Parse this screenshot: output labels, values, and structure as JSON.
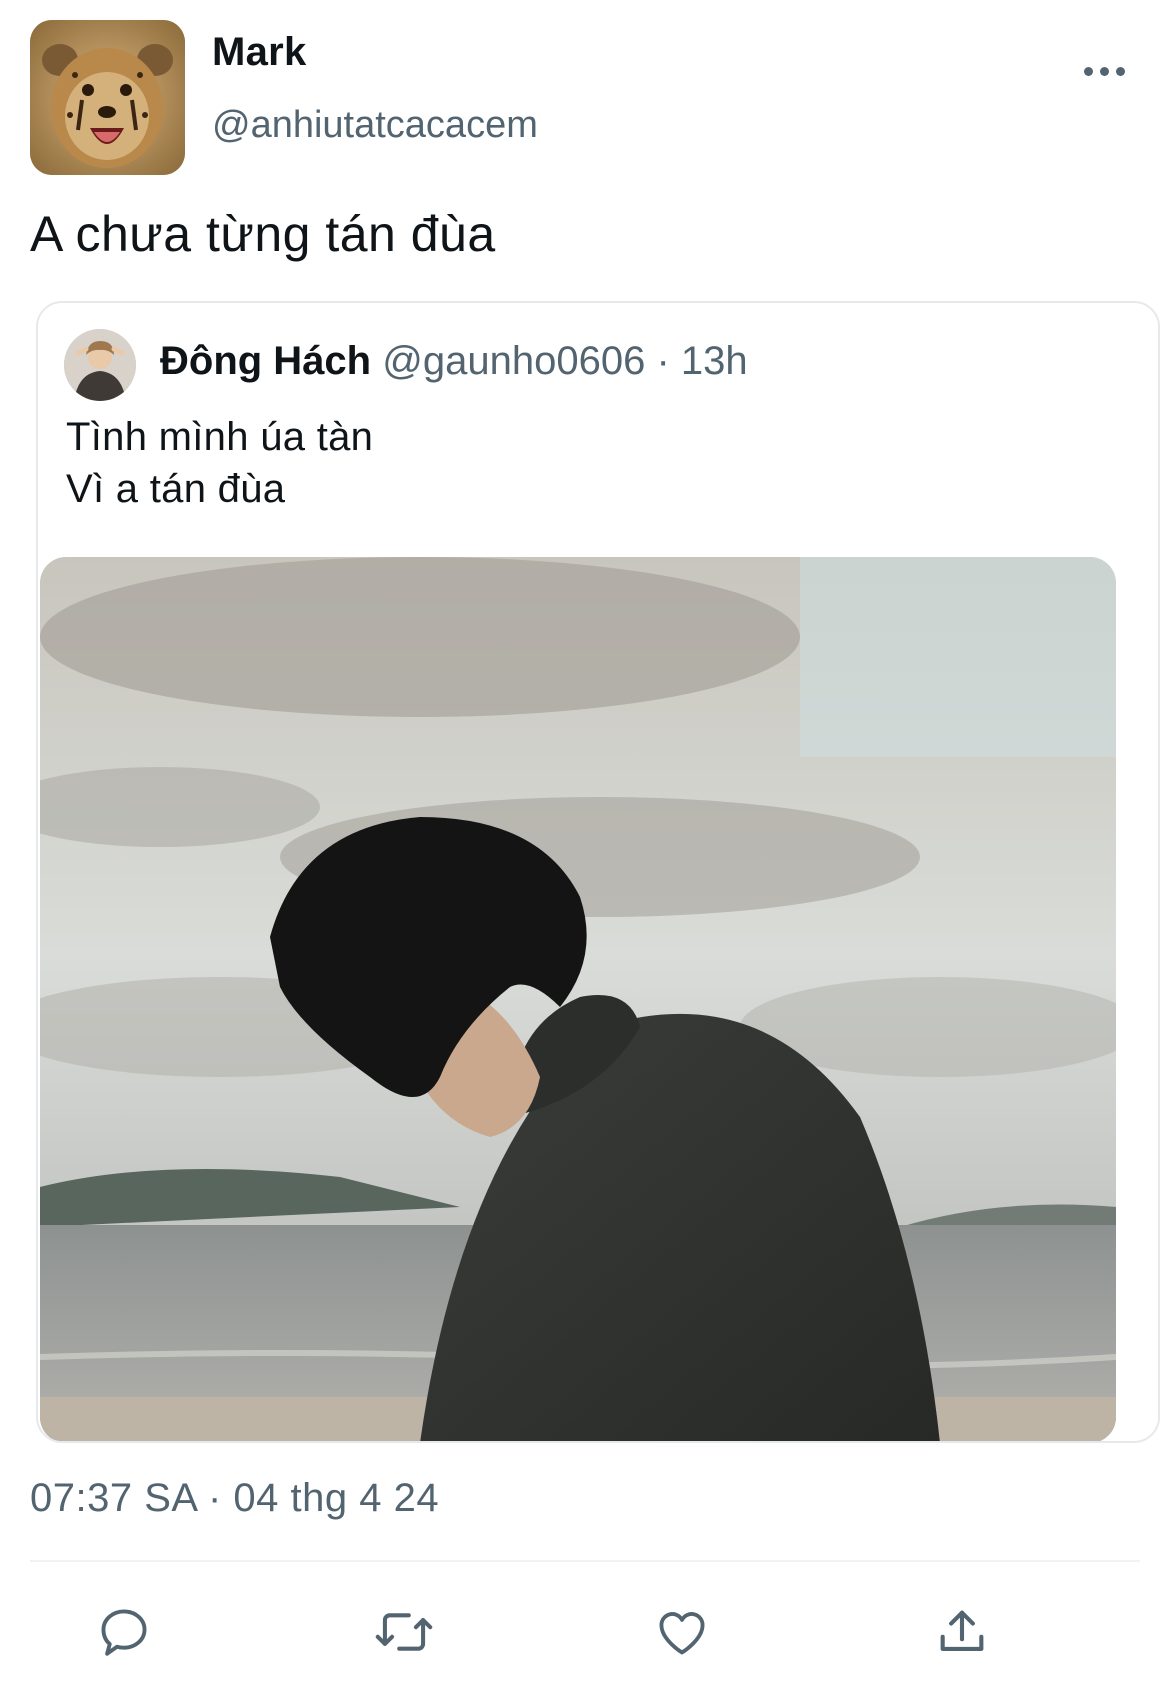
{
  "author": {
    "name": "Mark",
    "handle": "@anhiutatcacacem",
    "avatar_icon": "cheetah-cub-avatar"
  },
  "tweet": {
    "text": "A chưa từng tán đùa",
    "timestamp": "07:37 SA · 04 thg 4 24"
  },
  "quoted_tweet": {
    "name": "Đông Hách",
    "handle": "@gaunho0606",
    "separator": " · ",
    "time": "13h",
    "lines": [
      "Tình mình úa tàn",
      "Vì a tán đùa"
    ],
    "avatar_icon": "person-avatar",
    "photo_icon": "beach-portrait-photo"
  },
  "actions": [
    {
      "icon": "reply-icon"
    },
    {
      "icon": "retweet-icon"
    },
    {
      "icon": "like-icon"
    },
    {
      "icon": "share-icon"
    }
  ],
  "colors": {
    "text": "#0f1419",
    "secondary": "#536471",
    "border": "#e6e9eb"
  }
}
